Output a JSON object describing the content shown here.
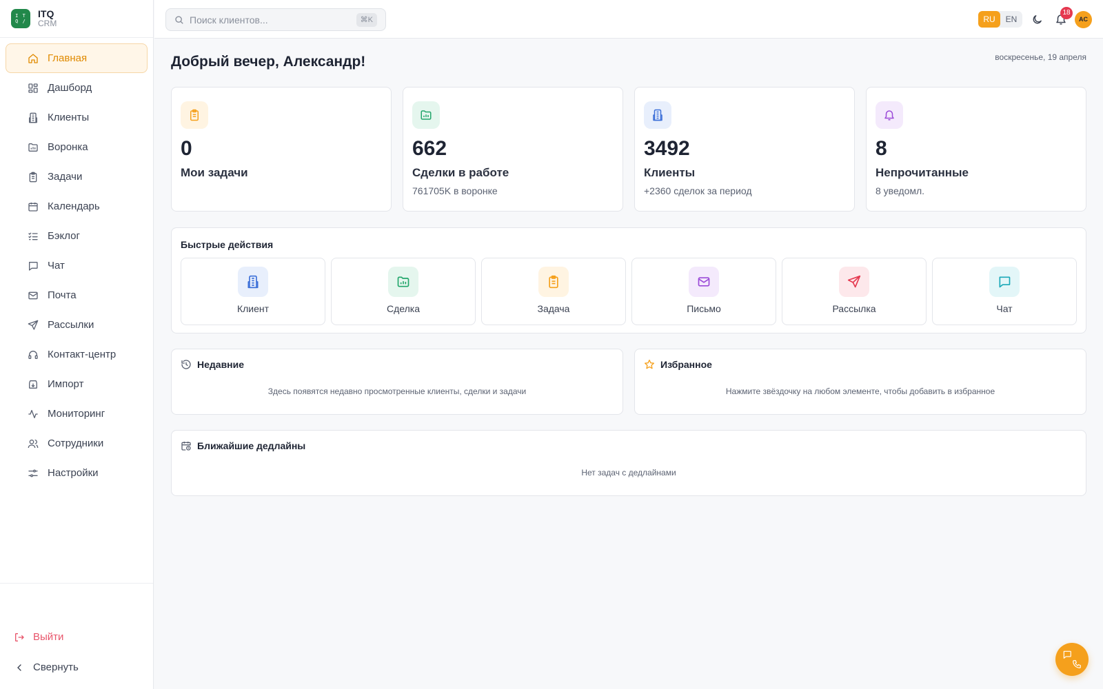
{
  "brand": {
    "logo_text": "I T\nQ /",
    "name": "ITQ",
    "subtitle": "CRM"
  },
  "sidebar": {
    "items": [
      {
        "label": "Главная",
        "icon": "home-icon",
        "active": true
      },
      {
        "label": "Дашборд",
        "icon": "dashboard-icon"
      },
      {
        "label": "Клиенты",
        "icon": "building-icon"
      },
      {
        "label": "Воронка",
        "icon": "folder-chart-icon"
      },
      {
        "label": "Задачи",
        "icon": "clipboard-icon"
      },
      {
        "label": "Календарь",
        "icon": "calendar-icon"
      },
      {
        "label": "Бэклог",
        "icon": "list-check-icon"
      },
      {
        "label": "Чат",
        "icon": "chat-icon"
      },
      {
        "label": "Почта",
        "icon": "mail-icon"
      },
      {
        "label": "Рассылки",
        "icon": "send-icon"
      },
      {
        "label": "Контакт-центр",
        "icon": "headset-icon"
      },
      {
        "label": "Импорт",
        "icon": "import-icon"
      },
      {
        "label": "Мониторинг",
        "icon": "activity-icon"
      },
      {
        "label": "Сотрудники",
        "icon": "users-icon"
      },
      {
        "label": "Настройки",
        "icon": "settings-icon"
      }
    ],
    "logout_label": "Выйти",
    "collapse_label": "Свернуть"
  },
  "header": {
    "search_placeholder": "Поиск клиентов...",
    "search_shortcut": "⌘K",
    "languages": [
      "RU",
      "EN"
    ],
    "active_language": "RU",
    "notification_count": "18",
    "avatar_initials": "AC"
  },
  "main": {
    "greeting": "Добрый вечер, Александр!",
    "date": "воскресенье, 19 апреля",
    "stats": [
      {
        "value": "0",
        "label": "Мои задачи",
        "sub": "",
        "icon": "clipboard-icon",
        "color": "#f5a01c",
        "bg": "#fff4e2"
      },
      {
        "value": "662",
        "label": "Сделки в работе",
        "sub": "761705K в воронке",
        "icon": "folder-chart-icon",
        "color": "#22a66b",
        "bg": "#e5f6ee"
      },
      {
        "value": "3492",
        "label": "Клиенты",
        "sub": "+2360 сделок за период",
        "icon": "building-icon",
        "color": "#3b6fd8",
        "bg": "#e8effc"
      },
      {
        "value": "8",
        "label": "Непрочитанные",
        "sub": "8 уведомл.",
        "icon": "bell-icon",
        "color": "#9b4ad8",
        "bg": "#f4eafc"
      }
    ],
    "quick_actions_title": "Быстрые действия",
    "quick_actions": [
      {
        "label": "Клиент",
        "icon": "building-icon",
        "color": "#3b6fd8",
        "bg": "#e8effc"
      },
      {
        "label": "Сделка",
        "icon": "folder-chart-icon",
        "color": "#22a66b",
        "bg": "#e5f6ee"
      },
      {
        "label": "Задача",
        "icon": "clipboard-icon",
        "color": "#f5a01c",
        "bg": "#fff4e2"
      },
      {
        "label": "Письмо",
        "icon": "mail-icon",
        "color": "#9b4ad8",
        "bg": "#f4eafc"
      },
      {
        "label": "Рассылка",
        "icon": "send-icon",
        "color": "#e5384f",
        "bg": "#fde8eb"
      },
      {
        "label": "Чат",
        "icon": "chat-icon",
        "color": "#1aa8b8",
        "bg": "#e3f6f8"
      }
    ],
    "recent": {
      "title": "Недавние",
      "text": "Здесь появятся недавно просмотренные клиенты, сделки и задачи"
    },
    "favorites": {
      "title": "Избранное",
      "text": "Нажмите звёздочку на любом элементе, чтобы добавить в избранное"
    },
    "deadlines": {
      "title": "Ближайшие дедлайны",
      "text": "Нет задач с дедлайнами"
    }
  },
  "colors": {
    "accent": "#f5a01c",
    "danger": "#e5384f",
    "brand": "#21884a"
  }
}
